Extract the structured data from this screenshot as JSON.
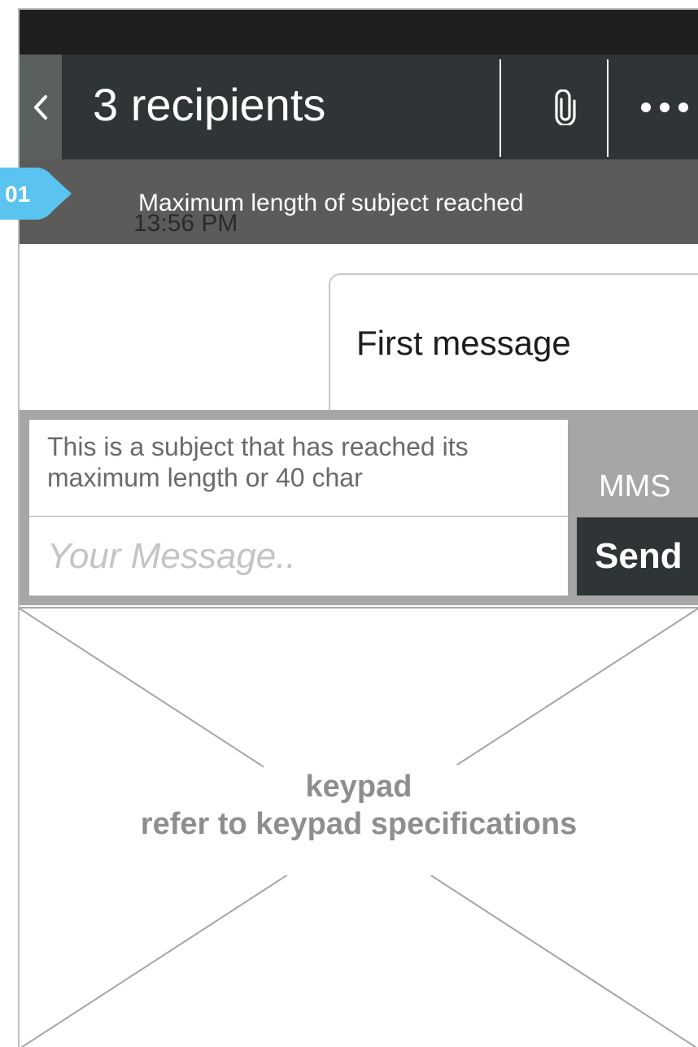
{
  "header": {
    "title": "3 recipients",
    "back_icon": "chevron-left-icon",
    "attach_icon": "paperclip-icon",
    "more_icon": "ellipsis-icon"
  },
  "notice": {
    "text": "Maximum length of subject reached",
    "timestamp": "13:56 PM"
  },
  "annotation": {
    "badge": "01"
  },
  "conversation": {
    "message": "First message"
  },
  "composer": {
    "subject": "This is a subject that has reached its maximum length or 40 char",
    "message_placeholder": "Your Message..",
    "message_value": "",
    "mms_label": "MMS",
    "send_label": "Send"
  },
  "keypad": {
    "title": "keypad",
    "subtitle": "refer to keypad specifications"
  },
  "colors": {
    "header_bg": "#2f3537",
    "notice_bg": "#5b5b5a",
    "badge": "#5bc3ef",
    "composer_bg": "#a6a6a6",
    "send_bg": "#2f3537"
  }
}
